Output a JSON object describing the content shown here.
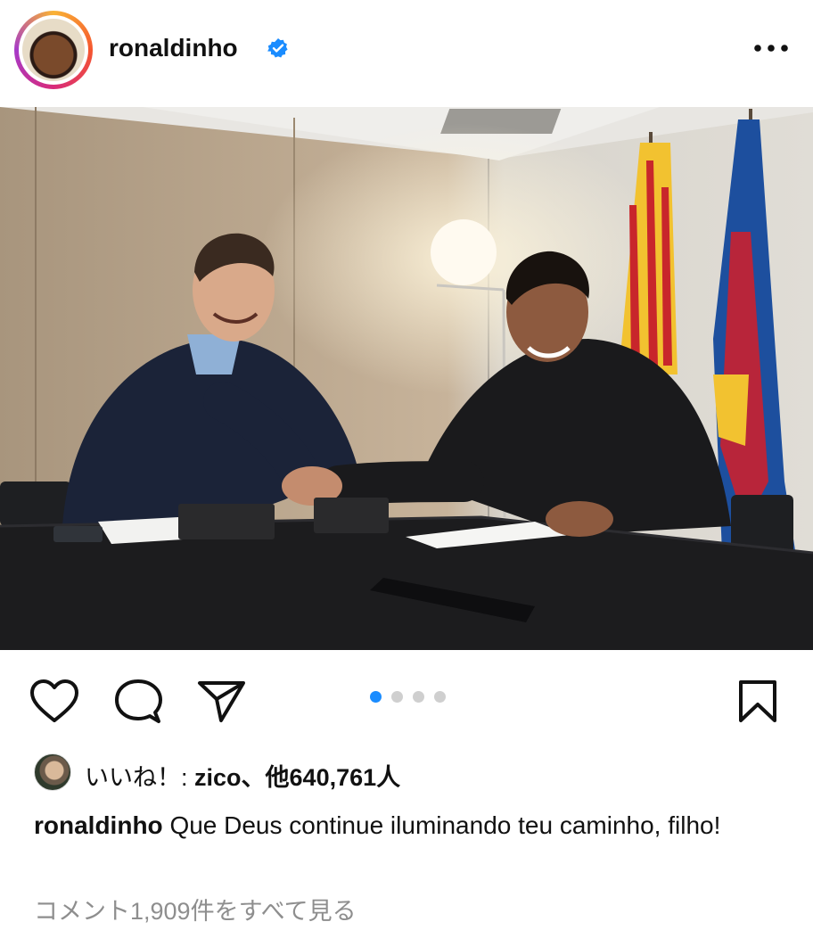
{
  "post": {
    "username": "ronaldinho",
    "verified": true,
    "more_icon": "more-horizontal-icon",
    "photo_alt": "",
    "carousel": {
      "count": 4,
      "active_index": 0,
      "active_color": "#1a8cff",
      "inactive_color": "#cfcfcf"
    },
    "actions": {
      "like_icon": "heart-icon",
      "comment_icon": "comment-icon",
      "share_icon": "send-icon",
      "save_icon": "bookmark-icon"
    },
    "likes": {
      "prefix": "いいね！: ",
      "first_liker": "zico",
      "separator": "、",
      "others_prefix": "他",
      "others_count": "640,761人"
    },
    "caption": {
      "username": "ronaldinho",
      "text": "Que Deus continue iluminando teu caminho, filho!"
    },
    "comments_link": "コメント1,909件をすべて見る"
  },
  "colors": {
    "verified_blue": "#1a8cff",
    "muted_text": "#8e8e8e",
    "story_ring": [
      "#f9b234",
      "#f5562f",
      "#d82a7a",
      "#a63ac8"
    ]
  }
}
